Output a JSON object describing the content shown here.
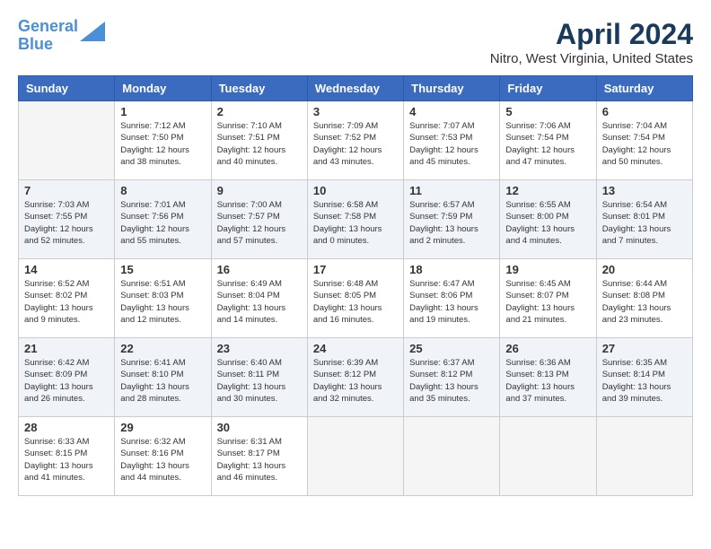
{
  "logo": {
    "line1": "General",
    "line2": "Blue"
  },
  "title": "April 2024",
  "location": "Nitro, West Virginia, United States",
  "days_of_week": [
    "Sunday",
    "Monday",
    "Tuesday",
    "Wednesday",
    "Thursday",
    "Friday",
    "Saturday"
  ],
  "weeks": [
    [
      {
        "date": "",
        "empty": true
      },
      {
        "date": "1",
        "sunrise": "7:12 AM",
        "sunset": "7:50 PM",
        "daylight": "12 hours and 38 minutes."
      },
      {
        "date": "2",
        "sunrise": "7:10 AM",
        "sunset": "7:51 PM",
        "daylight": "12 hours and 40 minutes."
      },
      {
        "date": "3",
        "sunrise": "7:09 AM",
        "sunset": "7:52 PM",
        "daylight": "12 hours and 43 minutes."
      },
      {
        "date": "4",
        "sunrise": "7:07 AM",
        "sunset": "7:53 PM",
        "daylight": "12 hours and 45 minutes."
      },
      {
        "date": "5",
        "sunrise": "7:06 AM",
        "sunset": "7:54 PM",
        "daylight": "12 hours and 47 minutes."
      },
      {
        "date": "6",
        "sunrise": "7:04 AM",
        "sunset": "7:54 PM",
        "daylight": "12 hours and 50 minutes."
      }
    ],
    [
      {
        "date": "7",
        "sunrise": "7:03 AM",
        "sunset": "7:55 PM",
        "daylight": "12 hours and 52 minutes."
      },
      {
        "date": "8",
        "sunrise": "7:01 AM",
        "sunset": "7:56 PM",
        "daylight": "12 hours and 55 minutes."
      },
      {
        "date": "9",
        "sunrise": "7:00 AM",
        "sunset": "7:57 PM",
        "daylight": "12 hours and 57 minutes."
      },
      {
        "date": "10",
        "sunrise": "6:58 AM",
        "sunset": "7:58 PM",
        "daylight": "13 hours and 0 minutes."
      },
      {
        "date": "11",
        "sunrise": "6:57 AM",
        "sunset": "7:59 PM",
        "daylight": "13 hours and 2 minutes."
      },
      {
        "date": "12",
        "sunrise": "6:55 AM",
        "sunset": "8:00 PM",
        "daylight": "13 hours and 4 minutes."
      },
      {
        "date": "13",
        "sunrise": "6:54 AM",
        "sunset": "8:01 PM",
        "daylight": "13 hours and 7 minutes."
      }
    ],
    [
      {
        "date": "14",
        "sunrise": "6:52 AM",
        "sunset": "8:02 PM",
        "daylight": "13 hours and 9 minutes."
      },
      {
        "date": "15",
        "sunrise": "6:51 AM",
        "sunset": "8:03 PM",
        "daylight": "13 hours and 12 minutes."
      },
      {
        "date": "16",
        "sunrise": "6:49 AM",
        "sunset": "8:04 PM",
        "daylight": "13 hours and 14 minutes."
      },
      {
        "date": "17",
        "sunrise": "6:48 AM",
        "sunset": "8:05 PM",
        "daylight": "13 hours and 16 minutes."
      },
      {
        "date": "18",
        "sunrise": "6:47 AM",
        "sunset": "8:06 PM",
        "daylight": "13 hours and 19 minutes."
      },
      {
        "date": "19",
        "sunrise": "6:45 AM",
        "sunset": "8:07 PM",
        "daylight": "13 hours and 21 minutes."
      },
      {
        "date": "20",
        "sunrise": "6:44 AM",
        "sunset": "8:08 PM",
        "daylight": "13 hours and 23 minutes."
      }
    ],
    [
      {
        "date": "21",
        "sunrise": "6:42 AM",
        "sunset": "8:09 PM",
        "daylight": "13 hours and 26 minutes."
      },
      {
        "date": "22",
        "sunrise": "6:41 AM",
        "sunset": "8:10 PM",
        "daylight": "13 hours and 28 minutes."
      },
      {
        "date": "23",
        "sunrise": "6:40 AM",
        "sunset": "8:11 PM",
        "daylight": "13 hours and 30 minutes."
      },
      {
        "date": "24",
        "sunrise": "6:39 AM",
        "sunset": "8:12 PM",
        "daylight": "13 hours and 32 minutes."
      },
      {
        "date": "25",
        "sunrise": "6:37 AM",
        "sunset": "8:12 PM",
        "daylight": "13 hours and 35 minutes."
      },
      {
        "date": "26",
        "sunrise": "6:36 AM",
        "sunset": "8:13 PM",
        "daylight": "13 hours and 37 minutes."
      },
      {
        "date": "27",
        "sunrise": "6:35 AM",
        "sunset": "8:14 PM",
        "daylight": "13 hours and 39 minutes."
      }
    ],
    [
      {
        "date": "28",
        "sunrise": "6:33 AM",
        "sunset": "8:15 PM",
        "daylight": "13 hours and 41 minutes."
      },
      {
        "date": "29",
        "sunrise": "6:32 AM",
        "sunset": "8:16 PM",
        "daylight": "13 hours and 44 minutes."
      },
      {
        "date": "30",
        "sunrise": "6:31 AM",
        "sunset": "8:17 PM",
        "daylight": "13 hours and 46 minutes."
      },
      {
        "date": "",
        "empty": true
      },
      {
        "date": "",
        "empty": true
      },
      {
        "date": "",
        "empty": true
      },
      {
        "date": "",
        "empty": true
      }
    ]
  ],
  "labels": {
    "sunrise_prefix": "Sunrise: ",
    "sunset_prefix": "Sunset: ",
    "daylight_prefix": "Daylight: "
  }
}
